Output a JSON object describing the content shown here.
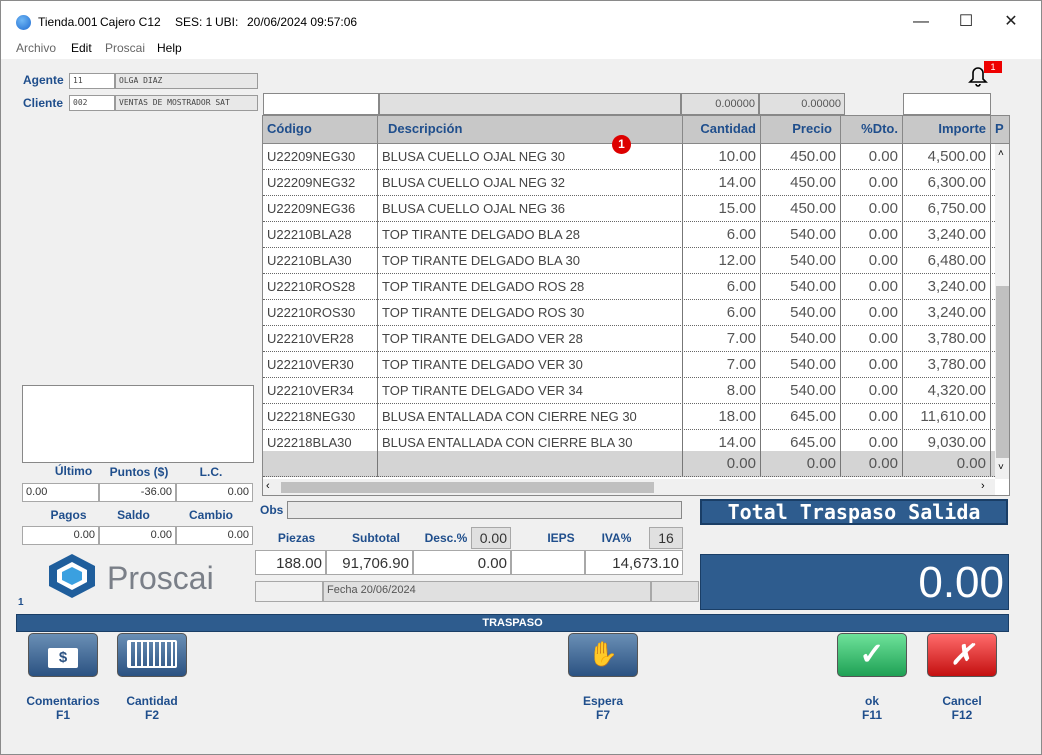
{
  "window": {
    "title_store": "Tienda.001",
    "title_cashier": "Cajero C12",
    "title_session": "SES: 1",
    "title_ubi": "UBI:",
    "title_datetime": "20/06/2024 09:57:06",
    "minimize": "—",
    "maximize": "☐",
    "close": "✕"
  },
  "menu": {
    "archivo": "Archivo",
    "edit": "Edit",
    "proscai": "Proscai",
    "help": "Help"
  },
  "customer": {
    "agent_label": "Agente",
    "agent_code": "11",
    "agent_name": "OLGA DIAZ",
    "client_label": "Cliente",
    "client_code": "002",
    "client_name": "VENTAS DE MOSTRADOR SAT"
  },
  "notification_count": "1",
  "top_inputs": {
    "qty_total": "0.00000",
    "price_total": "0.00000"
  },
  "grid": {
    "headers": {
      "codigo": "Código",
      "descripcion": "Descripción",
      "cantidad": "Cantidad",
      "precio": "Precio",
      "dto": "%Dto.",
      "importe": "Importe",
      "extra": "P"
    },
    "badge": "1",
    "rows": [
      {
        "code": "U22209NEG30",
        "desc": "BLUSA CUELLO OJAL NEG 30",
        "qty": "10.00",
        "price": "450.00",
        "dto": "0.00",
        "amount": "4,500.00"
      },
      {
        "code": "U22209NEG32",
        "desc": "BLUSA CUELLO OJAL NEG 32",
        "qty": "14.00",
        "price": "450.00",
        "dto": "0.00",
        "amount": "6,300.00"
      },
      {
        "code": "U22209NEG36",
        "desc": "BLUSA CUELLO OJAL NEG 36",
        "qty": "15.00",
        "price": "450.00",
        "dto": "0.00",
        "amount": "6,750.00"
      },
      {
        "code": "U22210BLA28",
        "desc": "TOP TIRANTE DELGADO BLA 28",
        "qty": "6.00",
        "price": "540.00",
        "dto": "0.00",
        "amount": "3,240.00"
      },
      {
        "code": "U22210BLA30",
        "desc": "TOP TIRANTE DELGADO BLA 30",
        "qty": "12.00",
        "price": "540.00",
        "dto": "0.00",
        "amount": "6,480.00"
      },
      {
        "code": "U22210ROS28",
        "desc": "TOP TIRANTE DELGADO ROS 28",
        "qty": "6.00",
        "price": "540.00",
        "dto": "0.00",
        "amount": "3,240.00"
      },
      {
        "code": "U22210ROS30",
        "desc": "TOP TIRANTE DELGADO ROS 30",
        "qty": "6.00",
        "price": "540.00",
        "dto": "0.00",
        "amount": "3,240.00"
      },
      {
        "code": "U22210VER28",
        "desc": "TOP TIRANTE DELGADO VER 28",
        "qty": "7.00",
        "price": "540.00",
        "dto": "0.00",
        "amount": "3,780.00"
      },
      {
        "code": "U22210VER30",
        "desc": "TOP TIRANTE DELGADO VER 30",
        "qty": "7.00",
        "price": "540.00",
        "dto": "0.00",
        "amount": "3,780.00"
      },
      {
        "code": "U22210VER34",
        "desc": "TOP TIRANTE DELGADO VER 34",
        "qty": "8.00",
        "price": "540.00",
        "dto": "0.00",
        "amount": "4,320.00"
      },
      {
        "code": "U22218NEG30",
        "desc": "BLUSA ENTALLADA CON CIERRE NEG 30",
        "qty": "18.00",
        "price": "645.00",
        "dto": "0.00",
        "amount": "11,610.00"
      },
      {
        "code": "U22218BLA30",
        "desc": "BLUSA ENTALLADA CON CIERRE BLA 30",
        "qty": "14.00",
        "price": "645.00",
        "dto": "0.00",
        "amount": "9,030.00"
      }
    ],
    "blank_row": {
      "qty": "0.00",
      "price": "0.00",
      "dto": "0.00",
      "amount": "0.00"
    }
  },
  "points": {
    "ultimo_label": "Último",
    "puntos_label": "Puntos ($)",
    "lc_label": "L.C.",
    "ultimo": "0.00",
    "puntos": "-36.00",
    "lc": "0.00",
    "pagos_label": "Pagos",
    "saldo_label": "Saldo",
    "cambio_label": "Cambio",
    "pagos": "0.00",
    "saldo": "0.00",
    "cambio": "0.00"
  },
  "brand": {
    "name": "Proscai",
    "page_num": "1"
  },
  "obs_label": "Obs",
  "summary": {
    "piezas_label": "Piezas",
    "subtotal_label": "Subtotal",
    "desc_label": "Desc.%",
    "desc_pct": "0.00",
    "ieps_label": "IEPS",
    "iva_label": "IVA%",
    "iva_pct": "16",
    "piezas": "188.00",
    "subtotal": "91,706.90",
    "desc_amount": "0.00",
    "iva_amount": "14,673.10",
    "fecha": "Fecha 20/06/2024"
  },
  "total": {
    "header": "Total Traspaso Salida",
    "value": "0.00"
  },
  "status": "TRASPASO",
  "buttons": {
    "comentarios": "Comentarios",
    "comentarios_key": "F1",
    "cantidad": "Cantidad",
    "cantidad_key": "F2",
    "espera": "Espera",
    "espera_key": "F7",
    "ok": "ok",
    "ok_key": "F11",
    "cancel": "Cancel",
    "cancel_key": "F12"
  }
}
